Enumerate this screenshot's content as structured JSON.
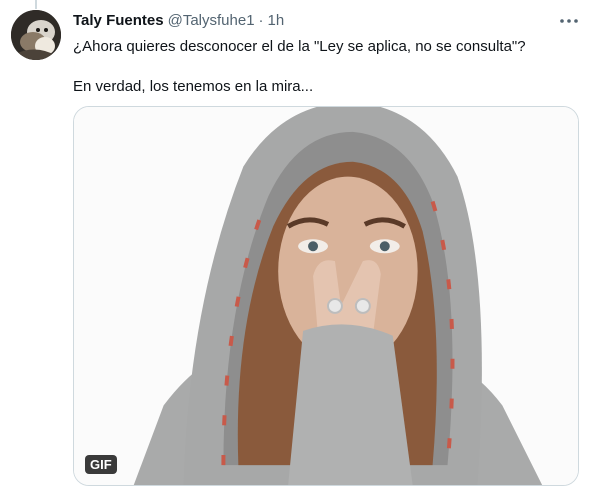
{
  "tweet": {
    "author_name": "Taly Fuentes",
    "handle": "@Talysfuhe1",
    "separator": "·",
    "time": "1h",
    "text_line1": "¿Ahora quieres desconocer el de la \"Ley se aplica, no se consulta\"?",
    "text_line2": "En verdad, los tenemos en la mira...",
    "media": {
      "badge": "GIF",
      "description_icon": "gif-media"
    }
  },
  "colors": {
    "text_primary": "#0f1419",
    "text_secondary": "#536471",
    "border": "#cfd9de"
  },
  "icons": {
    "more": "more-horizontal-icon",
    "avatar": "avatar-image"
  }
}
